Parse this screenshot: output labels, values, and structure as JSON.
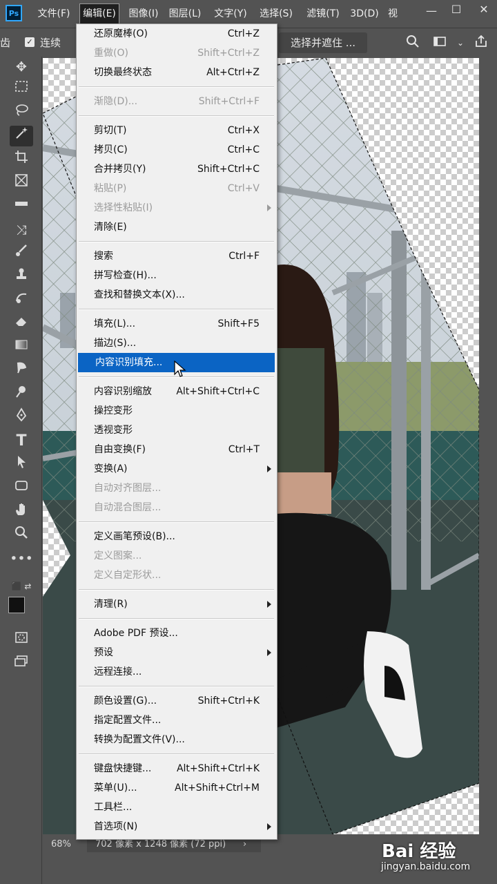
{
  "app": {
    "logo_text": "Ps"
  },
  "menubar": {
    "items": [
      "文件(F)",
      "编辑(E)",
      "图像(I)",
      "图层(L)",
      "文字(Y)",
      "选择(S)",
      "滤镜(T)",
      "3D(D)",
      "视"
    ],
    "active_index": 1
  },
  "window_controls": {
    "minimize": "—",
    "maximize": "☐",
    "close": "✕"
  },
  "options_bar": {
    "left_label": "齿",
    "contiguous_label": "连续",
    "select_mask_label": "选择并遮住 ..."
  },
  "edit_menu": {
    "highlight_color": "#0b64c4",
    "items": [
      {
        "label": "还原魔棒(O)",
        "shortcut": "Ctrl+Z",
        "disabled": false
      },
      {
        "label": "重做(O)",
        "shortcut": "Shift+Ctrl+Z",
        "disabled": true
      },
      {
        "label": "切换最终状态",
        "shortcut": "Alt+Ctrl+Z",
        "disabled": false
      },
      {
        "sep": true
      },
      {
        "label": "渐隐(D)...",
        "shortcut": "Shift+Ctrl+F",
        "disabled": true
      },
      {
        "sep": true
      },
      {
        "label": "剪切(T)",
        "shortcut": "Ctrl+X",
        "disabled": false
      },
      {
        "label": "拷贝(C)",
        "shortcut": "Ctrl+C",
        "disabled": false
      },
      {
        "label": "合并拷贝(Y)",
        "shortcut": "Shift+Ctrl+C",
        "disabled": false
      },
      {
        "label": "粘贴(P)",
        "shortcut": "Ctrl+V",
        "disabled": true
      },
      {
        "label": "选择性粘贴(I)",
        "shortcut": "",
        "disabled": true,
        "submenu": true
      },
      {
        "label": "清除(E)",
        "shortcut": "",
        "disabled": false
      },
      {
        "sep": true
      },
      {
        "label": "搜索",
        "shortcut": "Ctrl+F",
        "disabled": false
      },
      {
        "label": "拼写检查(H)...",
        "shortcut": "",
        "disabled": false
      },
      {
        "label": "查找和替换文本(X)...",
        "shortcut": "",
        "disabled": false
      },
      {
        "sep": true
      },
      {
        "label": "填充(L)...",
        "shortcut": "Shift+F5",
        "disabled": false
      },
      {
        "label": "描边(S)...",
        "shortcut": "",
        "disabled": false
      },
      {
        "label": "内容识别填充...",
        "shortcut": "",
        "disabled": false,
        "highlighted": true
      },
      {
        "sep": true
      },
      {
        "label": "内容识别缩放",
        "shortcut": "Alt+Shift+Ctrl+C",
        "disabled": false
      },
      {
        "label": "操控变形",
        "shortcut": "",
        "disabled": false
      },
      {
        "label": "透视变形",
        "shortcut": "",
        "disabled": false
      },
      {
        "label": "自由变换(F)",
        "shortcut": "Ctrl+T",
        "disabled": false
      },
      {
        "label": "变换(A)",
        "shortcut": "",
        "disabled": false,
        "submenu": true
      },
      {
        "label": "自动对齐图层...",
        "shortcut": "",
        "disabled": true
      },
      {
        "label": "自动混合图层...",
        "shortcut": "",
        "disabled": true
      },
      {
        "sep": true
      },
      {
        "label": "定义画笔预设(B)...",
        "shortcut": "",
        "disabled": false
      },
      {
        "label": "定义图案...",
        "shortcut": "",
        "disabled": true
      },
      {
        "label": "定义自定形状...",
        "shortcut": "",
        "disabled": true
      },
      {
        "sep": true
      },
      {
        "label": "清理(R)",
        "shortcut": "",
        "disabled": false,
        "submenu": true
      },
      {
        "sep": true
      },
      {
        "label": "Adobe PDF 预设...",
        "shortcut": "",
        "disabled": false
      },
      {
        "label": "预设",
        "shortcut": "",
        "disabled": false,
        "submenu": true
      },
      {
        "label": "远程连接...",
        "shortcut": "",
        "disabled": false
      },
      {
        "sep": true
      },
      {
        "label": "颜色设置(G)...",
        "shortcut": "Shift+Ctrl+K",
        "disabled": false
      },
      {
        "label": "指定配置文件...",
        "shortcut": "",
        "disabled": false
      },
      {
        "label": "转换为配置文件(V)...",
        "shortcut": "",
        "disabled": false
      },
      {
        "sep": true
      },
      {
        "label": "键盘快捷键...",
        "shortcut": "Alt+Shift+Ctrl+K",
        "disabled": false
      },
      {
        "label": "菜单(U)...",
        "shortcut": "Alt+Shift+Ctrl+M",
        "disabled": false
      },
      {
        "label": "工具栏...",
        "shortcut": "",
        "disabled": false
      },
      {
        "label": "首选项(N)",
        "shortcut": "",
        "disabled": false,
        "submenu": true
      }
    ]
  },
  "tools": [
    "move-tool",
    "marquee-tool",
    "lasso-tool",
    "magic-wand-tool",
    "crop-tool",
    "frame-tool",
    "ruler-tool",
    "healing-tool",
    "brush-tool",
    "stamp-tool",
    "history-brush-tool",
    "eraser-tool",
    "gradient-tool",
    "smudge-tool",
    "dodge-tool",
    "pen-tool",
    "type-tool",
    "path-select-tool",
    "shape-tool",
    "hand-tool",
    "zoom-tool",
    "more-tools"
  ],
  "status_bar": {
    "zoom": "68%",
    "dimensions": "702 像素 x 1248 像素 (72 ppi)",
    "arrow": "›"
  },
  "watermark": {
    "logo": "Bai 经验",
    "url": "jingyan.baidu.com"
  }
}
